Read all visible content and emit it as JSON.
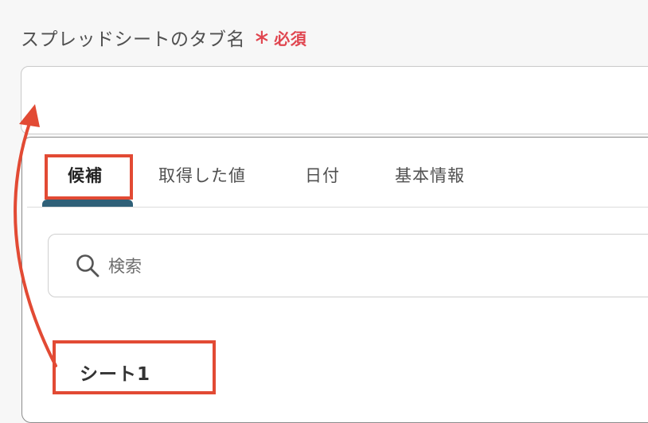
{
  "field": {
    "label": "スプレッドシートのタブ名",
    "required_mark": "∗",
    "required_text": "必須",
    "value": ""
  },
  "panel": {
    "tabs": [
      {
        "label": "候補",
        "active": true
      },
      {
        "label": "取得した値",
        "active": false
      },
      {
        "label": "日付",
        "active": false
      },
      {
        "label": "基本情報",
        "active": false
      }
    ],
    "search": {
      "icon": "search-icon",
      "placeholder": "検索"
    },
    "items": [
      {
        "label": "シート1"
      }
    ]
  },
  "colors": {
    "required": "#e0454f",
    "active_tab_indicator": "#2f6078",
    "annotation": "#e24a34"
  }
}
